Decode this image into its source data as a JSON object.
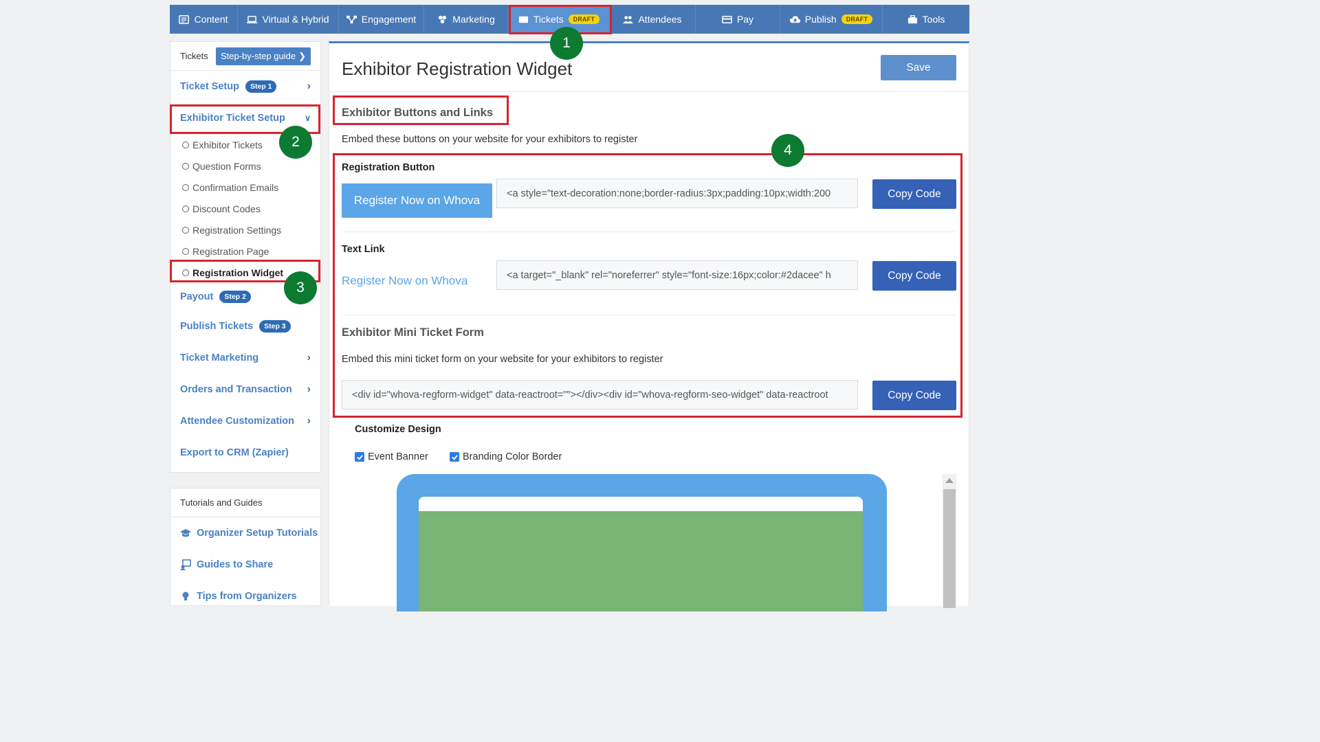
{
  "nav": {
    "items": [
      {
        "label": "Content",
        "icon": "content-icon"
      },
      {
        "label": "Virtual & Hybrid",
        "icon": "monitor-icon"
      },
      {
        "label": "Engagement",
        "icon": "engagement-icon"
      },
      {
        "label": "Marketing",
        "icon": "marketing-icon"
      },
      {
        "label": "Tickets",
        "icon": "ticket-icon",
        "badge": "DRAFT"
      },
      {
        "label": "Attendees",
        "icon": "attendees-icon"
      },
      {
        "label": "Pay",
        "icon": "card-icon"
      },
      {
        "label": "Publish",
        "icon": "cloud-upload-icon",
        "badge": "DRAFT"
      },
      {
        "label": "Tools",
        "icon": "toolbox-icon"
      }
    ],
    "active": "Tickets"
  },
  "sidebar": {
    "header": "Tickets",
    "guide_button": "Step-by-step guide",
    "ticket_setup": {
      "label": "Ticket Setup",
      "step": "Step 1"
    },
    "exhibitor_setup": {
      "label": "Exhibitor Ticket Setup"
    },
    "sub_items": [
      "Exhibitor Tickets",
      "Question Forms",
      "Confirmation Emails",
      "Discount Codes",
      "Registration Settings",
      "Registration Page",
      "Registration Widget"
    ],
    "payout": {
      "label": "Payout",
      "step": "Step 2"
    },
    "publish": {
      "label": "Publish Tickets",
      "step": "Step 3"
    },
    "ticket_marketing": "Ticket Marketing",
    "orders": "Orders and Transaction",
    "attendee_custom": "Attendee Customization",
    "export_crm": "Export to CRM (Zapier)"
  },
  "tutorials": {
    "header": "Tutorials and Guides",
    "items": [
      {
        "label": "Organizer Setup Tutorials",
        "icon": "graduation-cap-icon"
      },
      {
        "label": "Guides to Share",
        "icon": "share-guide-icon"
      },
      {
        "label": "Tips from Organizers",
        "icon": "lightbulb-icon"
      }
    ]
  },
  "main": {
    "title": "Exhibitor Registration Widget",
    "save": "Save",
    "section_title": "Exhibitor Buttons and Links",
    "section_desc": "Embed these buttons on your website for your exhibitors to register",
    "reg_button_label": "Registration Button",
    "reg_button_text": "Register Now on Whova",
    "reg_button_code": "<a style=\"text-decoration:none;border-radius:3px;padding:10px;width:200",
    "text_link_label": "Text Link",
    "text_link_text": "Register Now on Whova",
    "text_link_code": "<a target=\"_blank\" rel=\"noreferrer\" style=\"font-size:16px;color:#2dacee\" h",
    "mini_title": "Exhibitor Mini Ticket Form",
    "mini_desc": "Embed this mini ticket form on your website for your exhibitors to register",
    "mini_code": "<div id=\"whova-regform-widget\" data-reactroot=\"\"></div><div id=\"whova-regform-seo-widget\" data-reactroot",
    "copy_code": "Copy Code",
    "customize_title": "Customize Design",
    "event_banner": "Event Banner",
    "branding_border": "Branding Color Border"
  },
  "annotations": [
    "1",
    "2",
    "3",
    "4"
  ],
  "colors": {
    "nav_bg": "#4877b5",
    "accent": "#4a81c4",
    "copy_button": "#3561b7",
    "whova_blue": "#5ba6e7",
    "draft_badge": "#f5d20f",
    "annotation_red": "#d9232d",
    "annotation_green": "#0d7a32"
  }
}
